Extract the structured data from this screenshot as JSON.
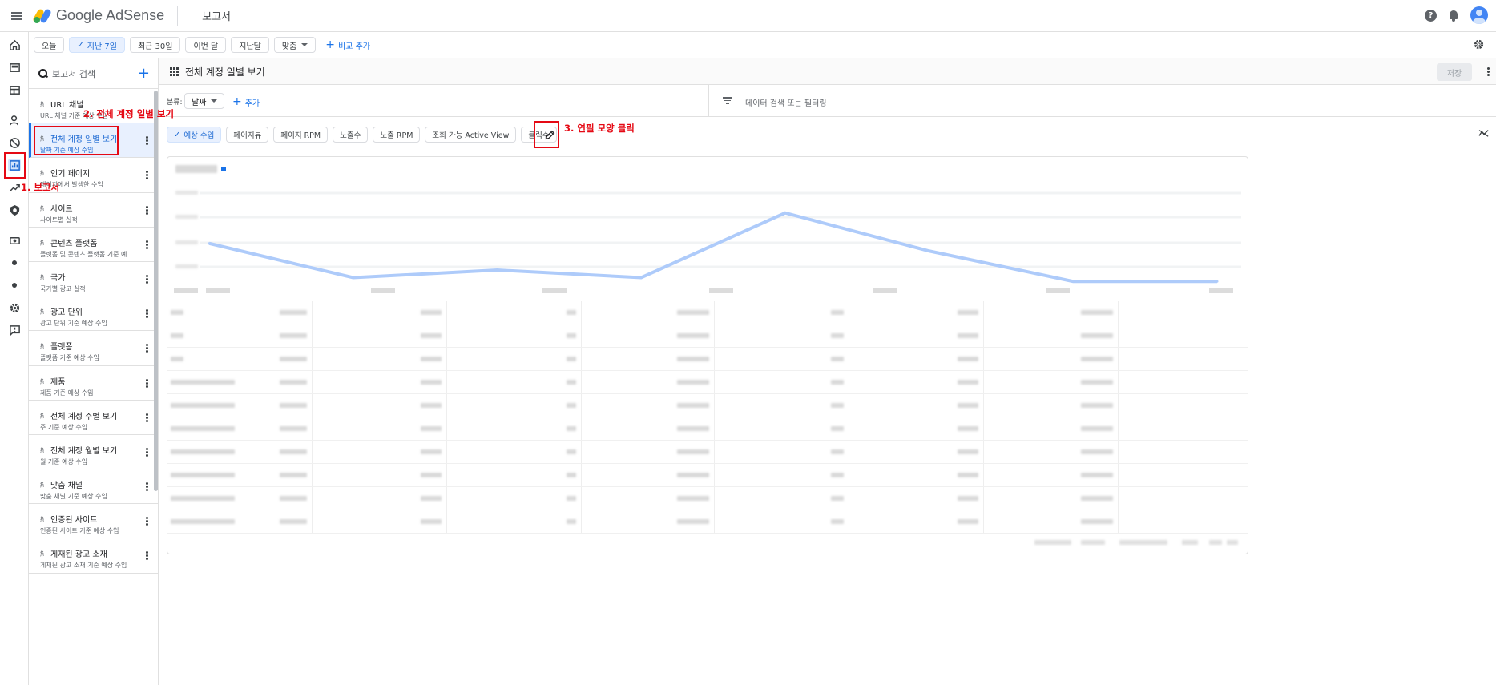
{
  "app": {
    "name_prefix": "Google",
    "name_suffix": "AdSense",
    "page_title": "보고서"
  },
  "date_chips": [
    {
      "label": "오늘",
      "selected": false
    },
    {
      "label": "지난 7일",
      "selected": true
    },
    {
      "label": "최근 30일",
      "selected": false
    },
    {
      "label": "이번 달",
      "selected": false
    },
    {
      "label": "지난달",
      "selected": false
    },
    {
      "label": "맞춤",
      "selected": false,
      "dropdown": true
    }
  ],
  "compare_label": "비교 추가",
  "reports_panel": {
    "search_placeholder": "보고서 검색",
    "items": [
      {
        "title": "URL 채널",
        "subtitle": "URL 채널 기준 예상 수입",
        "active": false
      },
      {
        "title": "전체 계정 일별 보기",
        "subtitle": "날짜 기준 예상 수입",
        "active": true
      },
      {
        "title": "인기 페이지",
        "subtitle": "페이지에서 발생한 수입",
        "active": false
      },
      {
        "title": "사이트",
        "subtitle": "사이트별 실적",
        "active": false
      },
      {
        "title": "콘텐츠 플랫폼",
        "subtitle": "플랫폼 및 콘텐츠 플랫폼 기준 예...",
        "active": false
      },
      {
        "title": "국가",
        "subtitle": "국가별 광고 실적",
        "active": false
      },
      {
        "title": "광고 단위",
        "subtitle": "광고 단위 기준 예상 수입",
        "active": false
      },
      {
        "title": "플랫폼",
        "subtitle": "플랫폼 기준 예상 수입",
        "active": false
      },
      {
        "title": "제품",
        "subtitle": "제품 기준 예상 수입",
        "active": false
      },
      {
        "title": "전체 계정 주별 보기",
        "subtitle": "주 기준 예상 수입",
        "active": false
      },
      {
        "title": "전체 계정 월별 보기",
        "subtitle": "월 기준 예상 수입",
        "active": false
      },
      {
        "title": "맞춤 채널",
        "subtitle": "맞춤 채널 기준 예상 수입",
        "active": false
      },
      {
        "title": "인증된 사이트",
        "subtitle": "인증된 사이트 기준 예상 수입",
        "active": false
      },
      {
        "title": "게재된 광고 소재",
        "subtitle": "게재된 광고 소재 기준 예상 수입",
        "active": false
      }
    ]
  },
  "main": {
    "title": "전체 계정 일별 보기",
    "save_label": "저장",
    "breakdown_label": "분류:",
    "breakdown_value": "날짜",
    "add_label": "추가",
    "filter_placeholder": "데이터 검색 또는 필터링",
    "metrics": [
      {
        "label": "예상 수입",
        "selected": true
      },
      {
        "label": "페이지뷰",
        "selected": false
      },
      {
        "label": "페이지 RPM",
        "selected": false
      },
      {
        "label": "노출수",
        "selected": false
      },
      {
        "label": "노출 RPM",
        "selected": false
      },
      {
        "label": "조회 가능 Active View",
        "selected": false
      },
      {
        "label": "클릭수",
        "selected": false
      }
    ]
  },
  "chart_data": {
    "type": "line",
    "x": [
      0,
      1,
      2,
      3,
      4,
      5,
      6,
      7
    ],
    "series": [
      {
        "values": [
          0.55,
          0.1,
          0.2,
          0.1,
          0.95,
          0.45,
          0.05,
          0.05
        ]
      }
    ],
    "note_blurred": true
  },
  "annotations": {
    "step1": "1. 보고서",
    "step2": "2. 전체 계정 일별 보기",
    "step3": "3. 연필 모양 클릭"
  },
  "colors": {
    "accent": "#1a73e8",
    "annotation": "#e50914",
    "line": "#aecbfa"
  }
}
